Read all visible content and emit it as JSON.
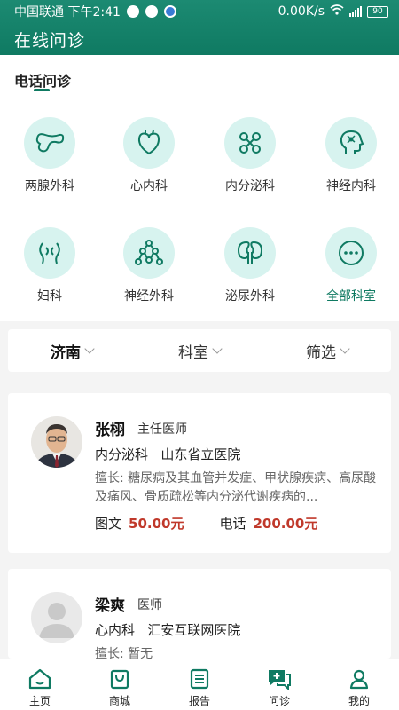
{
  "status": {
    "carrier": "中国联通 下午2:41",
    "speed": "0.00K/s",
    "battery": "90"
  },
  "app": {
    "title": "在线问诊"
  },
  "section": {
    "title": "电话问诊"
  },
  "departments": [
    {
      "label": "两腺外科",
      "icon": "pancreas-icon"
    },
    {
      "label": "心内科",
      "icon": "heart-icon"
    },
    {
      "label": "内分泌科",
      "icon": "hormone-molecule-icon"
    },
    {
      "label": "神经内科",
      "icon": "head-neuron-icon"
    },
    {
      "label": "妇科",
      "icon": "uterus-icon"
    },
    {
      "label": "神经外科",
      "icon": "neuron-network-icon"
    },
    {
      "label": "泌尿外科",
      "icon": "kidney-icon"
    },
    {
      "label": "全部科室",
      "icon": "more-icon"
    }
  ],
  "filters": [
    {
      "label": "济南"
    },
    {
      "label": "科室"
    },
    {
      "label": "筛选"
    }
  ],
  "doctors": [
    {
      "name": "张栩",
      "title": "主任医师",
      "department": "内分泌科",
      "hospital": "山东省立医院",
      "specialty": "擅长: 糖尿病及其血管并发症、甲状腺疾病、高尿酸及痛风、骨质疏松等内分泌代谢疾病的...",
      "image_label": "图文",
      "image_price": "50.00元",
      "phone_label": "电话",
      "phone_price": "200.00元"
    },
    {
      "name": "梁爽",
      "title": "医师",
      "department": "心内科",
      "hospital": "汇安互联网医院",
      "specialty": "擅长: 暂无"
    }
  ],
  "tabs": [
    {
      "label": "主页",
      "icon": "home-icon"
    },
    {
      "label": "商城",
      "icon": "shopping-bag-icon"
    },
    {
      "label": "报告",
      "icon": "report-icon"
    },
    {
      "label": "问诊",
      "icon": "consult-chat-icon"
    },
    {
      "label": "我的",
      "icon": "user-icon"
    }
  ],
  "colors": {
    "brand": "#0f7a62",
    "icon_bg": "#d7f3ef",
    "price": "#c0392b"
  }
}
